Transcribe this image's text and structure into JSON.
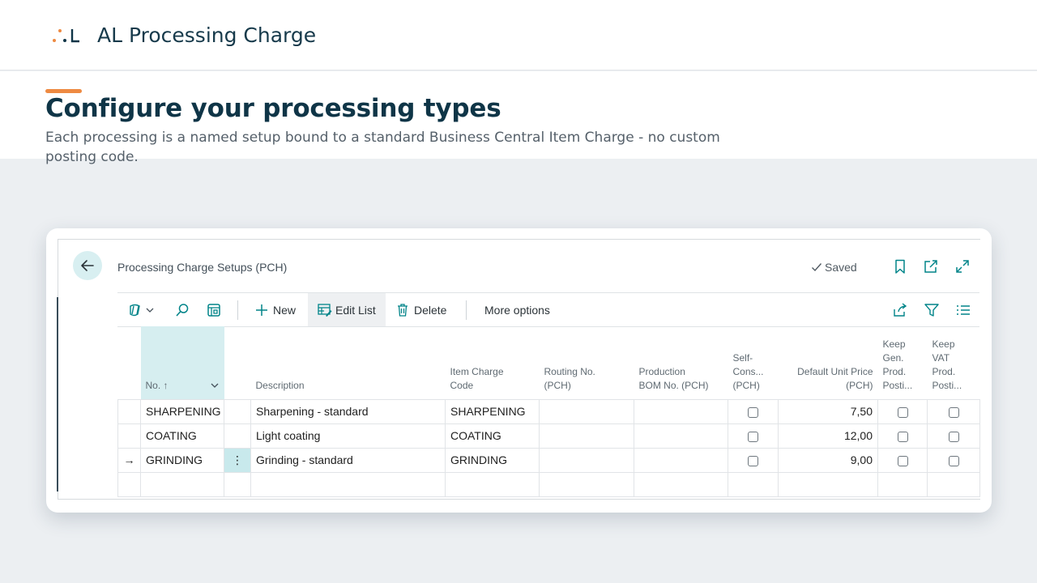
{
  "app": {
    "title": "AL Processing Charge"
  },
  "hero": {
    "title": "Configure your processing types",
    "subtitle": "Each processing is a named setup bound to a standard Business Central Item Charge - no custom posting code."
  },
  "page": {
    "caption": "Processing Charge Setups (PCH)",
    "status": "Saved"
  },
  "actions": {
    "new": "New",
    "edit_list": "Edit List",
    "delete": "Delete",
    "more": "More options"
  },
  "columns": {
    "no": "No.",
    "no_sort": "↑",
    "description": "Description",
    "item_charge_1": "Item Charge",
    "item_charge_2": "Code",
    "routing_1": "Routing No.",
    "routing_2": "(PCH)",
    "bom_1": "Production",
    "bom_2": "BOM No. (PCH)",
    "self_1": "Self-",
    "self_2": "Cons...",
    "self_3": "(PCH)",
    "price_1": "Default Unit Price",
    "price_2": "(PCH)",
    "gen_1": "Keep",
    "gen_2": "Gen.",
    "gen_3": "Prod.",
    "gen_4": "Posti...",
    "vat_1": "Keep",
    "vat_2": "VAT",
    "vat_3": "Prod.",
    "vat_4": "Posti..."
  },
  "rows": [
    {
      "indicator": "",
      "no": "SHARPENING",
      "description": "Sharpening - standard",
      "item_charge": "SHARPENING",
      "price": "7,50",
      "dots": ""
    },
    {
      "indicator": "",
      "no": "COATING",
      "description": "Light coating",
      "item_charge": "COATING",
      "price": "12,00",
      "dots": ""
    },
    {
      "indicator": "→",
      "no": "GRINDING",
      "description": "Grinding - standard",
      "item_charge": "GRINDING",
      "price": "9,00",
      "dots": "⋮"
    }
  ],
  "colors": {
    "accent": "#ee8a42",
    "title": "#0f3547",
    "teal": "#008489",
    "selected": "#c8e9ec"
  },
  "icons": [
    "back-arrow-icon",
    "checkmark-icon",
    "bookmark-icon",
    "open-new-window-icon",
    "expand-icon",
    "copilot-icon",
    "search-icon",
    "view-icon",
    "plus-icon",
    "edit-list-icon",
    "delete-icon",
    "share-icon",
    "filter-icon",
    "list-icon"
  ]
}
